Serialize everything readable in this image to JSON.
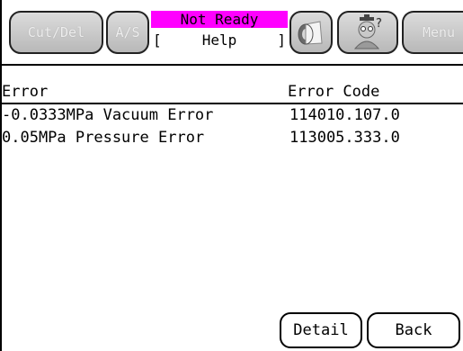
{
  "header": {
    "tab_1_label": "Cut/Del",
    "tab_2_label": "A/S",
    "status_text": "Not Ready",
    "help_left_bracket": "[",
    "help_label": "Help",
    "help_right_bracket": "]",
    "tab_right_label": "Menu",
    "status_color": "#ff00ff"
  },
  "table": {
    "columns": [
      "Error",
      "Error Code"
    ],
    "rows": [
      {
        "error": "-0.0333MPa Vacuum Error",
        "code": "114010.107.0"
      },
      {
        "error": "0.05MPa Pressure Error",
        "code": "113005.333.0"
      }
    ]
  },
  "buttons": {
    "detail": "Detail",
    "back": "Back"
  },
  "icons": {
    "paper_roll": "paper-roll-icon",
    "help_person": "help-person-icon"
  }
}
